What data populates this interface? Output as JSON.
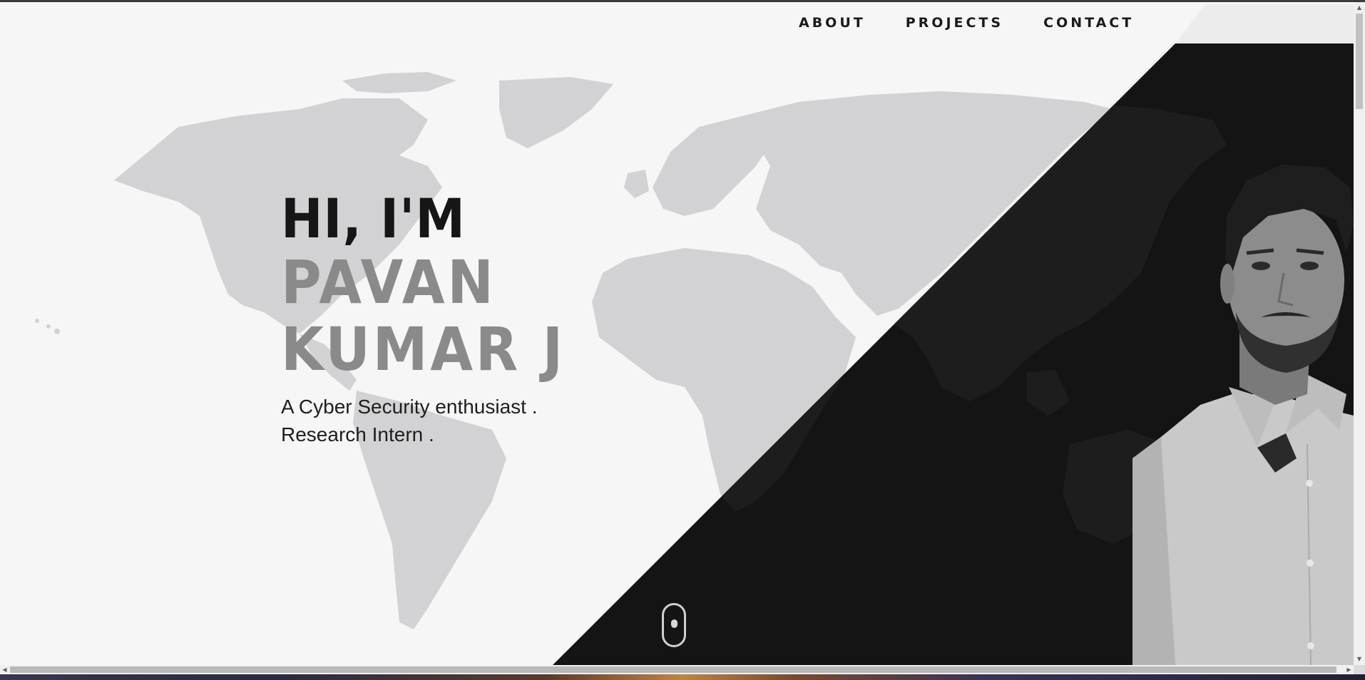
{
  "nav": {
    "items": [
      "ABOUT",
      "PROJECTS",
      "CONTACT"
    ]
  },
  "hero": {
    "greeting": "HI, I'M",
    "name_line1": "PAVAN",
    "name_line2": "KUMAR J",
    "tagline1": "A Cyber Security enthusiast .",
    "tagline2": "Research Intern ."
  },
  "colors": {
    "page_bg": "#f6f6f7",
    "dark_panel": "#141414",
    "map_light": "#d6d6d8",
    "name_gray": "#8a8a8a",
    "text_dark": "#161616"
  },
  "icons": {
    "scroll": "mouse-scroll-icon",
    "portrait": "profile-photo"
  }
}
